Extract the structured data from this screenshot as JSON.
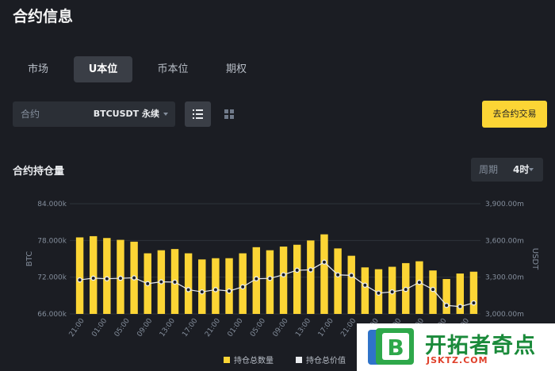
{
  "page": {
    "title": "合约信息"
  },
  "tabs": [
    {
      "label": "市场",
      "active": false
    },
    {
      "label": "U本位",
      "active": true
    },
    {
      "label": "币本位",
      "active": false
    },
    {
      "label": "期权",
      "active": false
    }
  ],
  "contract_select": {
    "label": "合约",
    "value": "BTCUSDT 永续"
  },
  "view_toggle": {
    "list_icon": "list-icon",
    "grid_icon": "grid-icon",
    "active": "list"
  },
  "trade_button": {
    "label": "去合约交易"
  },
  "section": {
    "title": "合约持仓量"
  },
  "period": {
    "label": "周期",
    "value": "4时"
  },
  "colors": {
    "accent": "#fcd535",
    "background": "#1b1d23",
    "panel": "#2b2f36",
    "line": "#ffffff"
  },
  "chart_data": {
    "type": "bar",
    "x": [
      "21:00",
      "01:00",
      "05:00",
      "09:00",
      "13:00",
      "17:00",
      "21:00",
      "01:00",
      "05:00",
      "09:00",
      "13:00",
      "17:00",
      "21:00",
      "01:00",
      "05:00",
      "09:00",
      "13:00",
      "17:00",
      "21:00",
      "01:00",
      "05:00",
      "09:00",
      "13:00",
      "17:00",
      "21:00",
      "01:00",
      "05:00",
      "09:00",
      "13:00",
      "17:00",
      "21:00",
      "01:00",
      "05:00",
      "09:00",
      "13:00",
      "17:00"
    ],
    "series": [
      {
        "name": "持仓总数量",
        "type": "bar",
        "axis": "left",
        "values": [
          78.5,
          78.7,
          78.4,
          78.1,
          77.8,
          75.9,
          76.4,
          76.6,
          75.9,
          74.9,
          75.1,
          75.1,
          75.9,
          76.9,
          76.4,
          77.0,
          77.3,
          78.0,
          79.0,
          76.7,
          75.5,
          73.6,
          73.3,
          73.7,
          74.3,
          74.6,
          73.1,
          71.7,
          72.6,
          72.9
        ]
      },
      {
        "name": "持仓总价值",
        "type": "line",
        "axis": "right",
        "values": [
          3278,
          3292,
          3287,
          3291,
          3295,
          3247,
          3262,
          3260,
          3198,
          3180,
          3198,
          3187,
          3221,
          3287,
          3290,
          3320,
          3357,
          3360,
          3423,
          3319,
          3315,
          3235,
          3170,
          3180,
          3200,
          3258,
          3200,
          3070,
          3060,
          3090
        ]
      }
    ],
    "y_left": {
      "label": "BTC",
      "ticks": [
        "66.000k",
        "72.000k",
        "78.000k",
        "84.000k"
      ],
      "range": [
        66,
        84
      ]
    },
    "y_right": {
      "label": "USDT",
      "ticks": [
        "3,000.00m",
        "3,300.00m",
        "3,600.00m",
        "3,900.00m"
      ],
      "range": [
        3000,
        3900
      ]
    },
    "x_tick_labels": [
      "21:00",
      "01:00",
      "05:00",
      "09:00",
      "13:00",
      "17:00",
      "21:00",
      "01:00",
      "05:00",
      "09:00",
      "13:00",
      "17:00",
      "21:00",
      "01:00",
      "05:00",
      "09:00",
      "13:00",
      "17:00"
    ],
    "grid": true,
    "legend": "bottom"
  },
  "watermark": {
    "title": "开拓者奇点",
    "url": "JSKTZ.COM",
    "logo_letter": "B"
  }
}
